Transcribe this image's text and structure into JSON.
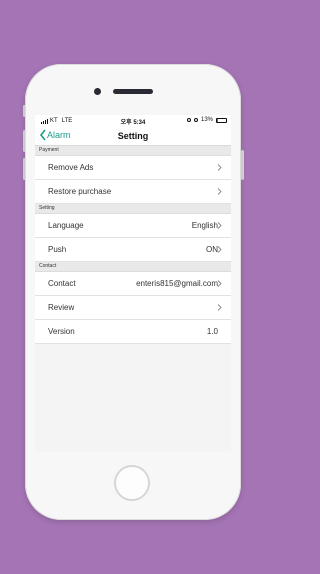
{
  "statusbar": {
    "carrier": "KT",
    "network": "LTE",
    "time": "오후 5:34",
    "battery": "13%"
  },
  "navbar": {
    "back_label": "Alarm",
    "title": "Setting"
  },
  "sections": [
    {
      "header": "Payment",
      "rows": [
        {
          "label": "Remove Ads",
          "value": "",
          "chevron": true
        },
        {
          "label": "Restore purchase",
          "value": "",
          "chevron": true
        }
      ]
    },
    {
      "header": "Setting",
      "rows": [
        {
          "label": "Language",
          "value": "English",
          "chevron": true
        },
        {
          "label": "Push",
          "value": "ON",
          "chevron": true
        }
      ]
    },
    {
      "header": "Contact",
      "rows": [
        {
          "label": "Contact",
          "value": "enteris815@gmail.com",
          "chevron": true
        },
        {
          "label": "Review",
          "value": "",
          "chevron": true
        },
        {
          "label": "Version",
          "value": "1.0",
          "chevron": false
        }
      ]
    }
  ],
  "colors": {
    "background": "#a474b4",
    "accent": "#1e9a8a",
    "battery_low": "#e03030"
  }
}
